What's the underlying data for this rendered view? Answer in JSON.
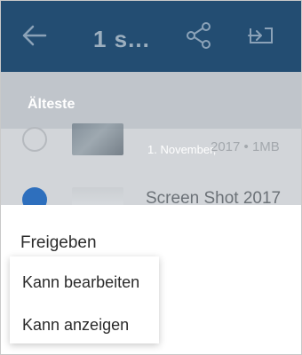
{
  "app_bar": {
    "title": "1 s...",
    "back_icon": "arrow-left-icon",
    "share_icon": "share-icon",
    "move_icon": "move-to-icon",
    "background": "#234d72"
  },
  "sort_bar": {
    "label": "Älteste"
  },
  "files": [
    {
      "date": "1. November,",
      "meta": "2017 • 1MB"
    },
    {
      "name": "Screen Shot 2017"
    }
  ],
  "share_sheet": {
    "title": "Freigeben",
    "menu": [
      {
        "label": "Kann bearbeiten"
      },
      {
        "label": "Kann anzeigen"
      }
    ]
  }
}
